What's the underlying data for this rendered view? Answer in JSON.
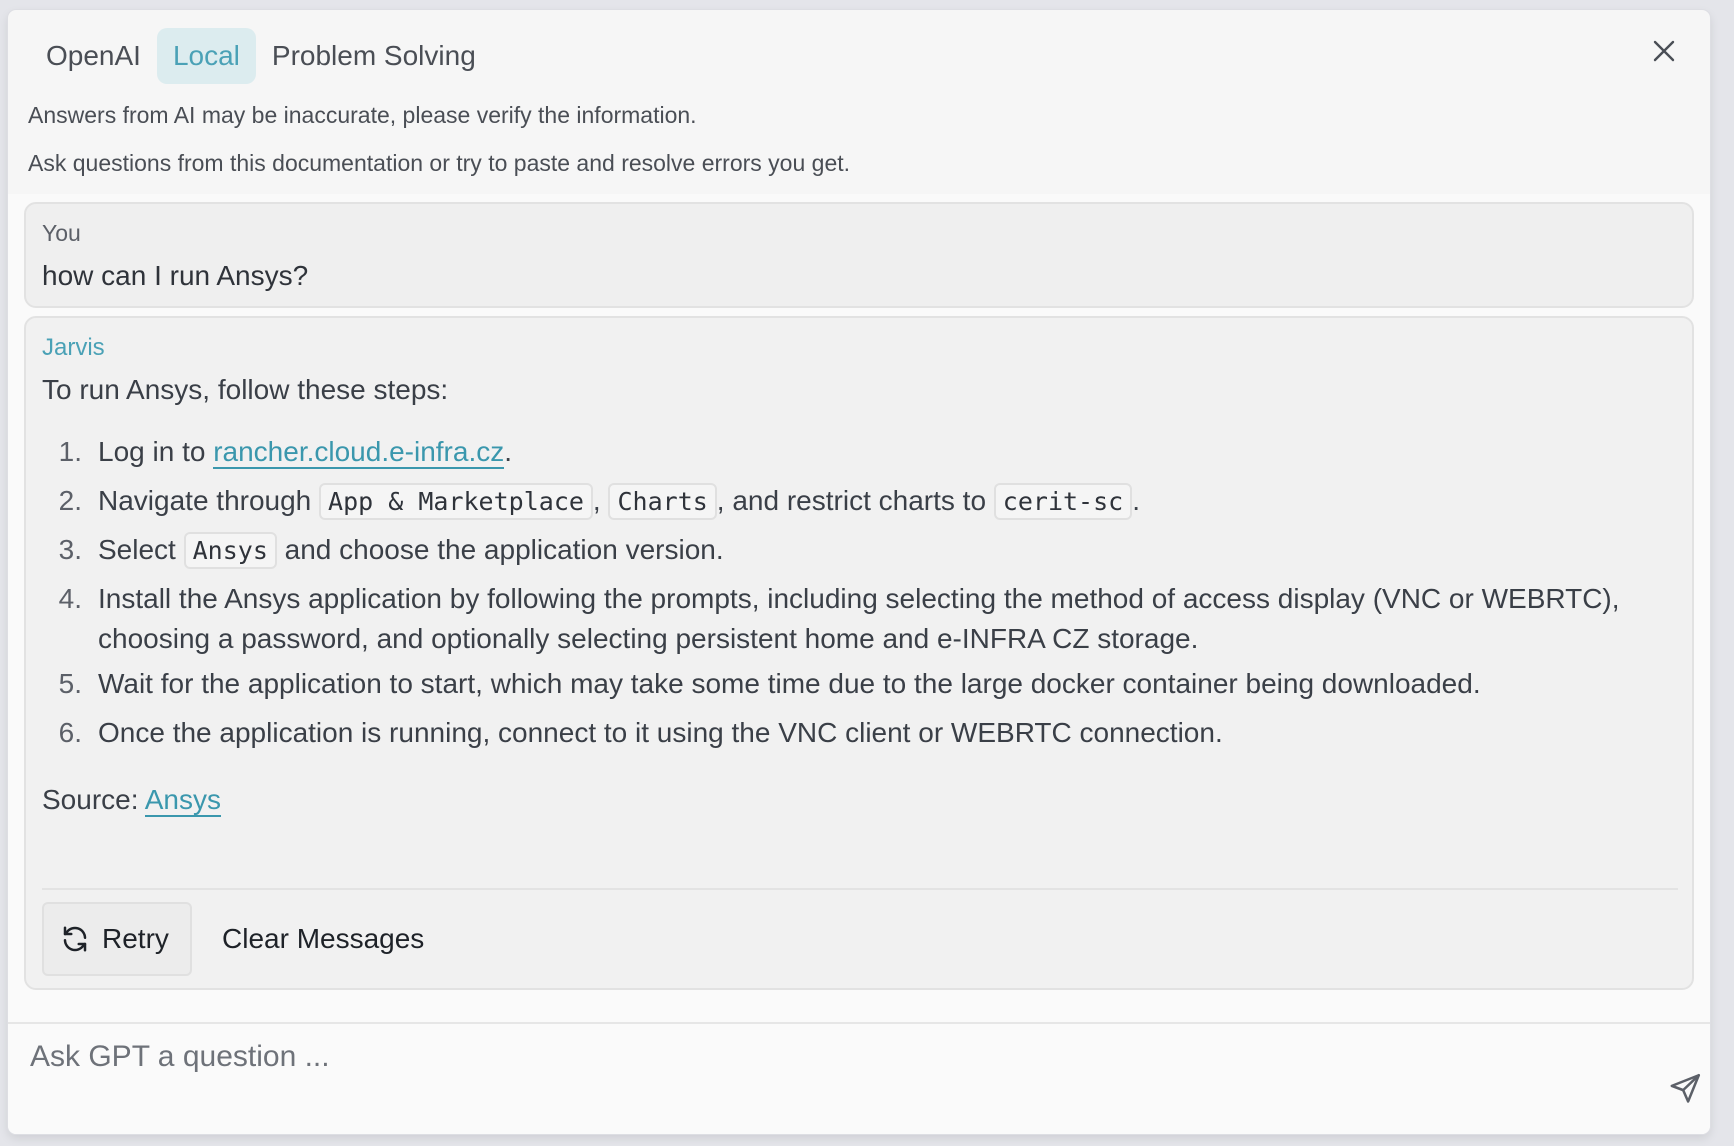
{
  "header": {
    "tabs": [
      {
        "label": "OpenAI",
        "active": false
      },
      {
        "label": "Local",
        "active": true
      },
      {
        "label": "Problem Solving",
        "active": false
      }
    ],
    "notice_1": "Answers from AI may be inaccurate, please verify the information.",
    "notice_2": "Ask questions from this documentation or try to paste and resolve errors you get.",
    "close_icon": "close-icon"
  },
  "conversation": {
    "user_message": {
      "author": "You",
      "text": "how can I run Ansys?"
    },
    "bot_message": {
      "author": "Jarvis",
      "intro": "To run Ansys, follow these steps:",
      "steps": {
        "s1": {
          "num": "1.",
          "pre": "Log in to ",
          "link": "rancher.cloud.e-infra.cz",
          "post": "."
        },
        "s2": {
          "num": "2.",
          "pre": "Navigate through ",
          "code1": "App & Marketplace",
          "sep1": ", ",
          "code2": "Charts",
          "mid": ", and restrict charts to ",
          "code3": "cerit-sc",
          "post": "."
        },
        "s3": {
          "num": "3.",
          "pre": "Select ",
          "code1": "Ansys",
          "post": " and choose the application version."
        },
        "s4": {
          "num": "4.",
          "line1": "Install the Ansys application by following the prompts, including selecting the method of access display (VNC or WEBRTC),",
          "line2": "choosing a password, and optionally selecting persistent home and e-INFRA CZ storage."
        },
        "s5": {
          "num": "5.",
          "text": "Wait for the application to start, which may take some time due to the large docker container being downloaded."
        },
        "s6": {
          "num": "6.",
          "text": "Once the application is running, connect to it using the VNC client or WEBRTC connection."
        }
      },
      "source_label": "Source: ",
      "source_link": "Ansys"
    },
    "actions": {
      "retry_label": "Retry",
      "clear_label": "Clear Messages"
    }
  },
  "input": {
    "placeholder": "Ask GPT a question ...",
    "value": ""
  },
  "colors": {
    "accent": "#4aa1b6",
    "active_tab_bg": "#dcecef"
  }
}
